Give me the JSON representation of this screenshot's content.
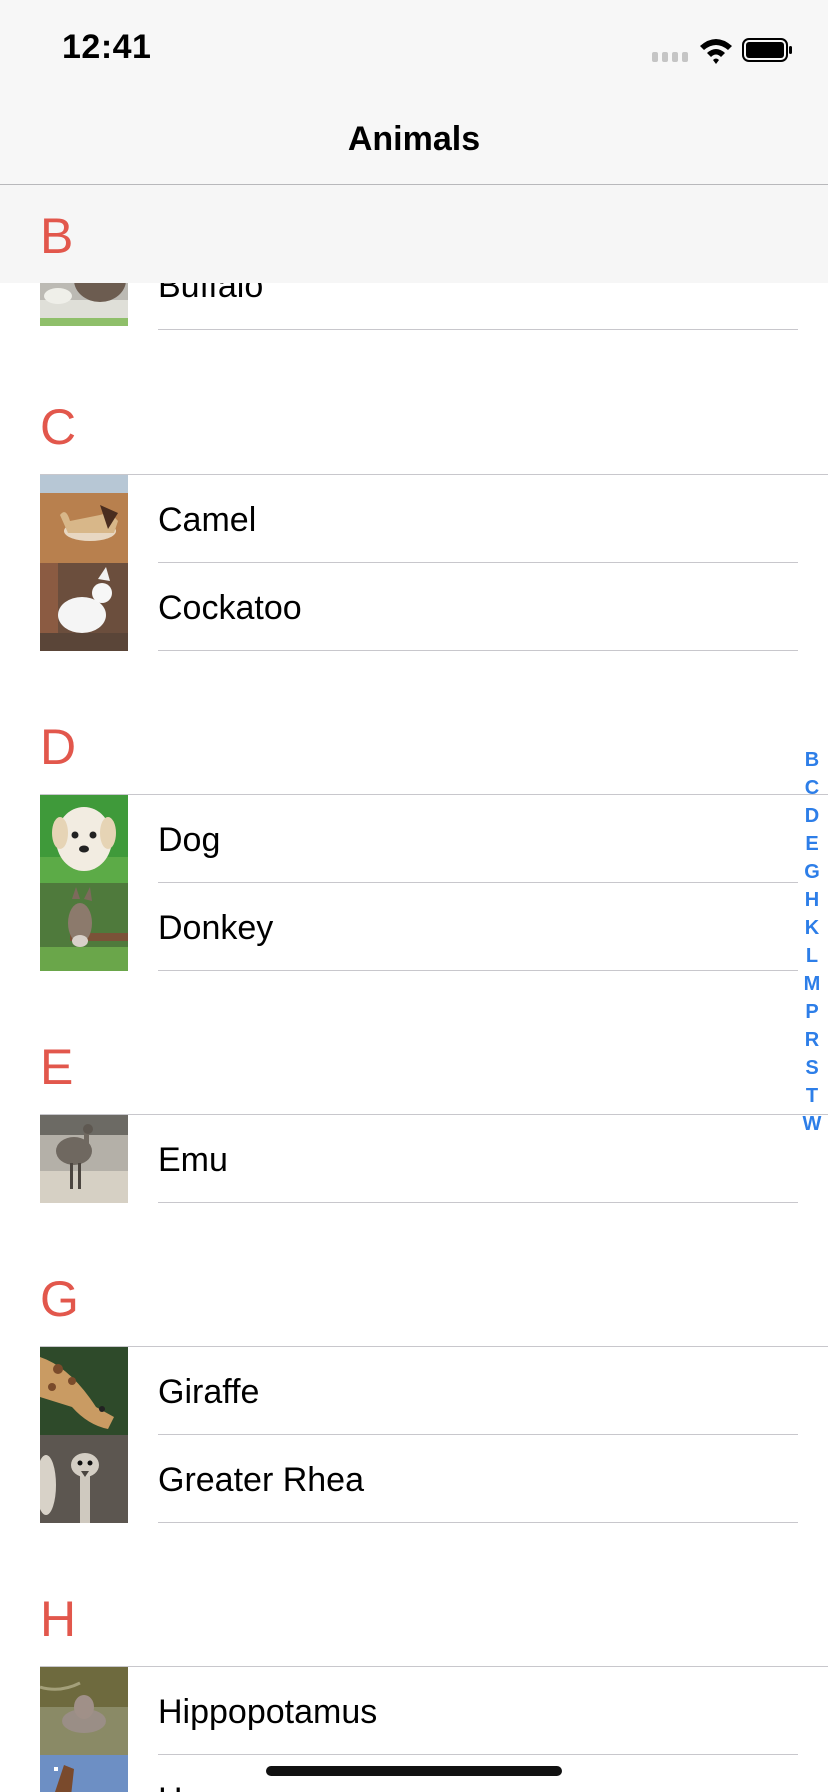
{
  "status_bar": {
    "time": "12:41"
  },
  "nav": {
    "title": "Animals"
  },
  "sticky_section": "B",
  "sections": [
    {
      "letter": "C"
    },
    {
      "letter": "D"
    },
    {
      "letter": "E"
    },
    {
      "letter": "G"
    },
    {
      "letter": "H"
    }
  ],
  "rows": {
    "buffalo": "Buffalo",
    "camel": "Camel",
    "cockatoo": "Cockatoo",
    "dog": "Dog",
    "donkey": "Donkey",
    "emu": "Emu",
    "giraffe": "Giraffe",
    "greater_rhea": "Greater Rhea",
    "hippopotamus": "Hippopotamus",
    "horse": "H"
  },
  "index_letters": [
    "B",
    "C",
    "D",
    "E",
    "G",
    "H",
    "K",
    "L",
    "M",
    "P",
    "R",
    "S",
    "T",
    "W"
  ],
  "colors": {
    "section_header": "#e2574c",
    "index": "#2d7ee8",
    "separator": "#c8c7cc"
  }
}
